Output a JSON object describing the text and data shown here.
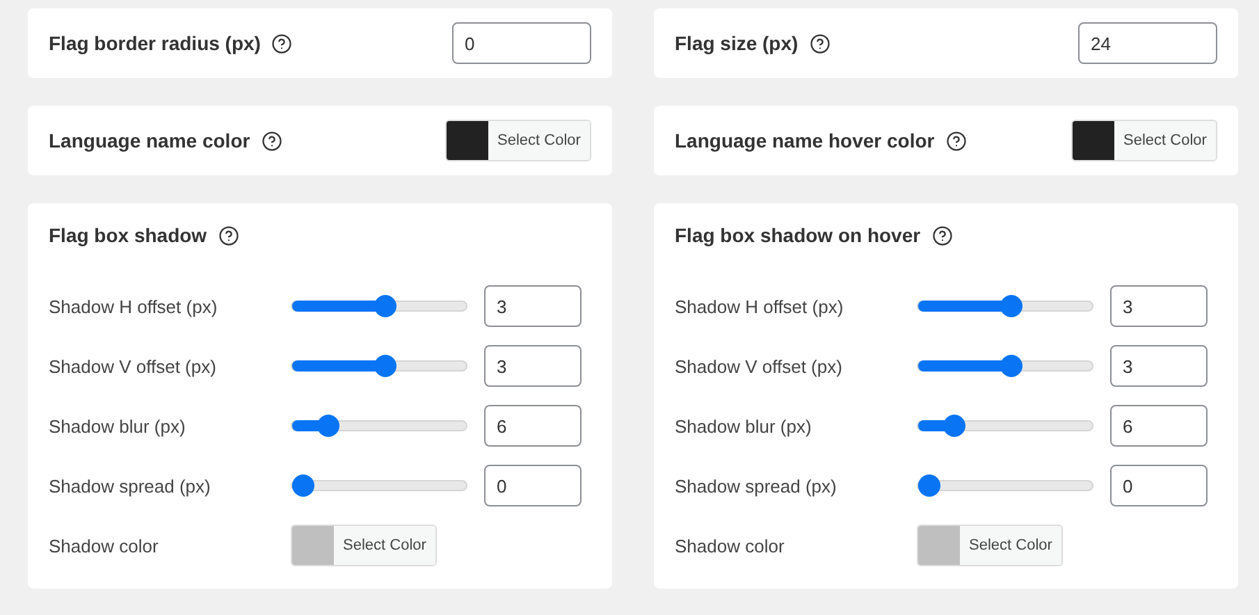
{
  "columns": [
    {
      "size_setting": {
        "label": "Flag border radius (px)",
        "value": "0"
      },
      "color_setting": {
        "label": "Language name color",
        "color": "#222222",
        "button": "Select Color"
      },
      "shadow": {
        "title": "Flag box shadow",
        "rows": [
          {
            "kind": "slider",
            "label": "Shadow H offset (px)",
            "level": 0.53,
            "value": "3"
          },
          {
            "kind": "slider",
            "label": "Shadow V offset (px)",
            "level": 0.53,
            "value": "3"
          },
          {
            "kind": "slider",
            "label": "Shadow blur (px)",
            "level": 0.16,
            "value": "6"
          },
          {
            "kind": "slider",
            "label": "Shadow spread (px)",
            "level": 0,
            "value": "0"
          },
          {
            "kind": "color",
            "label": "Shadow color",
            "color": "#bfbfbf",
            "button": "Select Color"
          }
        ]
      }
    },
    {
      "size_setting": {
        "label": "Flag size (px)",
        "value": "24"
      },
      "color_setting": {
        "label": "Language name hover color",
        "color": "#222222",
        "button": "Select Color"
      },
      "shadow": {
        "title": "Flag box shadow on hover",
        "rows": [
          {
            "kind": "slider",
            "label": "Shadow H offset (px)",
            "level": 0.53,
            "value": "3"
          },
          {
            "kind": "slider",
            "label": "Shadow V offset (px)",
            "level": 0.53,
            "value": "3"
          },
          {
            "kind": "slider",
            "label": "Shadow blur (px)",
            "level": 0.16,
            "value": "6"
          },
          {
            "kind": "slider",
            "label": "Shadow spread (px)",
            "level": 0,
            "value": "0"
          },
          {
            "kind": "color",
            "label": "Shadow color",
            "color": "#bfbfbf",
            "button": "Select Color"
          }
        ]
      }
    }
  ]
}
